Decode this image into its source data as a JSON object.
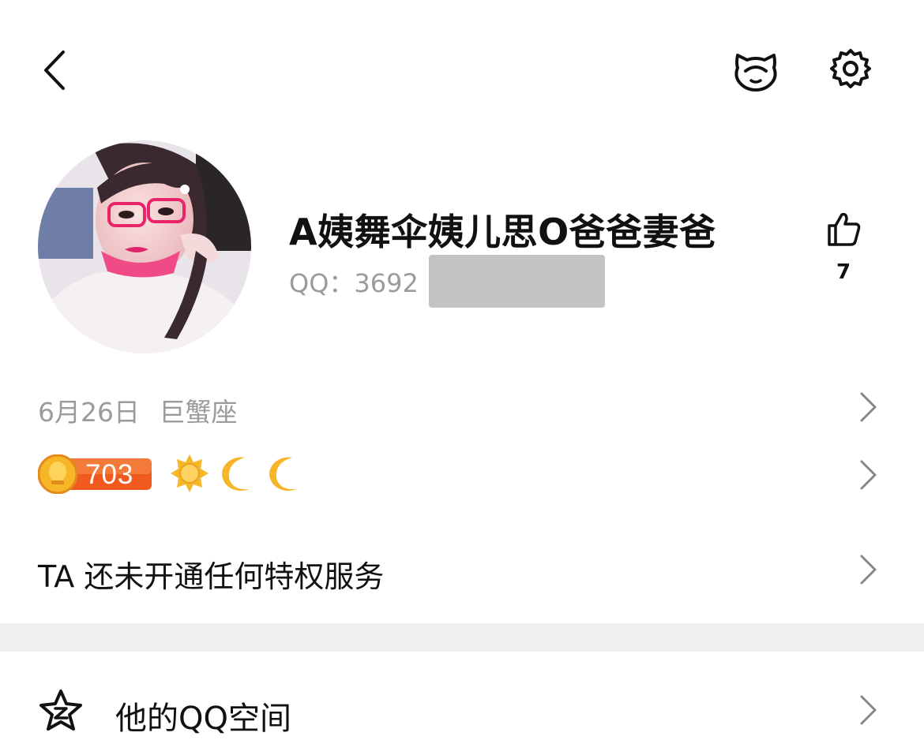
{
  "profile": {
    "nickname": "A姨舞伞姨儿思O爸爸妻爸",
    "qq_label": "QQ：3692",
    "like_count": "7"
  },
  "info": {
    "birthday": "6月26日",
    "constellation": "巨蟹座",
    "level": "703"
  },
  "privilege": {
    "text": "TA 还未开通任何特权服务"
  },
  "qzone": {
    "label": "他的QQ空间"
  },
  "icons": {
    "back": "chevron-left-icon",
    "pet": "pet-face-icon",
    "settings": "gear-icon",
    "like": "thumbs-up-icon",
    "sun": "sun-icon",
    "moon": "moon-icon",
    "qzone": "qzone-star-icon",
    "chevron": "chevron-right-icon"
  },
  "colors": {
    "level_badge": "#f05a1e",
    "level_accent": "#f7b528",
    "mask": "#c3c3c3",
    "secondary_text": "#9b9b9b",
    "divider": "#efeff1"
  }
}
